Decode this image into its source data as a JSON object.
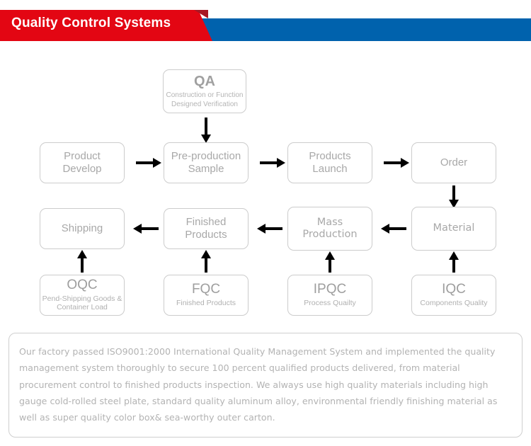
{
  "header": {
    "title": "Quality Control Systems",
    "red_color": "#e30613",
    "blue_color": "#0062ad",
    "text_color": "#ffffff"
  },
  "flowchart": {
    "box_border_color": "#cccccc",
    "box_text_color": "#a8a8a8",
    "arrow_color": "#000000",
    "qa_node": {
      "code": "QA",
      "desc_line1": "Construction or Function",
      "desc_line2": "Designed Verification"
    },
    "row1": [
      {
        "line1": "Product",
        "line2": "Develop"
      },
      {
        "line1": "Pre-production",
        "line2": "Sample"
      },
      {
        "line1": "Products",
        "line2": "Launch"
      },
      {
        "line1": "Order",
        "line2": ""
      }
    ],
    "row2": [
      {
        "line1": "Shipping",
        "line2": ""
      },
      {
        "line1": "Finished",
        "line2": "Products"
      },
      {
        "line1": "Mass",
        "line2": "Production"
      },
      {
        "line1": "Material",
        "line2": ""
      }
    ],
    "row3": [
      {
        "code": "OQC",
        "desc_line1": "Pend-Shipping Goods &",
        "desc_line2": "Container Load"
      },
      {
        "code": "FQC",
        "desc_line1": "Finished Products",
        "desc_line2": ""
      },
      {
        "code": "IPQC",
        "desc_line1": "Process Quailty",
        "desc_line2": ""
      },
      {
        "code": "IQC",
        "desc_line1": "Components Quality",
        "desc_line2": ""
      }
    ],
    "arrows": {
      "qa_to_preproduction": "arrow-down",
      "product_to_preproduction": "arrow-right",
      "preproduction_to_launch": "arrow-right",
      "launch_to_order": "arrow-right",
      "order_to_material": "arrow-down",
      "material_to_mass": "arrow-left",
      "mass_to_finished": "arrow-left",
      "finished_to_shipping": "arrow-left",
      "oqc_to_shipping": "arrow-up",
      "fqc_to_finished": "arrow-up",
      "ipqc_to_mass": "arrow-up",
      "iqc_to_material": "arrow-up"
    }
  },
  "footer": {
    "paragraph": "Our factory passed ISO9001:2000 International Quality Management System and  implemented the quality management system thoroughly to secure 100 percent qualified products delivered, from material procurement control to finished products inspection. We always use high quality materials including high gauge cold-rolled steel plate, standard quality aluminum alloy, environmental friendly finishing material as well as super quality color box& sea-worthy outer carton.",
    "text_color": "#b3b3b3",
    "border_color": "#cfcfcf"
  }
}
